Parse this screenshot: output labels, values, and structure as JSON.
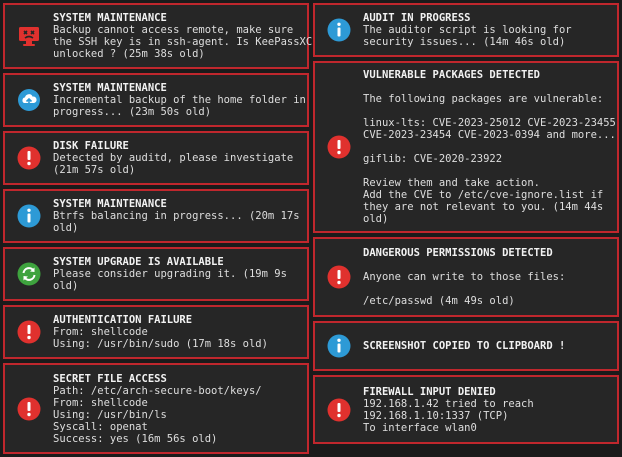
{
  "colors": {
    "border": "#c0272d",
    "background": "#262626",
    "danger": "#e0312e",
    "info": "#2d9ad6",
    "success": "#3ea33e"
  },
  "notifications": [
    {
      "id": "n1",
      "icon": "broken-screen-icon",
      "title": "SYSTEM MAINTENANCE",
      "lines": [
        "Backup cannot access remote, make sure",
        "the SSH key is in ssh-agent. Is KeePassXC",
        "unlocked ? (25m 38s old)"
      ]
    },
    {
      "id": "n2",
      "icon": "cloud-upload-icon",
      "title": "SYSTEM MAINTENANCE",
      "lines": [
        "Incremental backup of the home folder in",
        "progress... (23m 50s old)"
      ]
    },
    {
      "id": "n3",
      "icon": "exclamation-icon",
      "title": "DISK FAILURE",
      "lines": [
        "Detected by auditd, please investigate",
        "(21m 57s old)"
      ]
    },
    {
      "id": "n4",
      "icon": "info-icon",
      "title": "SYSTEM MAINTENANCE",
      "lines": [
        "Btrfs balancing in progress... (20m 17s",
        "old)"
      ]
    },
    {
      "id": "n5",
      "icon": "refresh-icon",
      "title": "SYSTEM UPGRADE IS AVAILABLE",
      "lines": [
        "Please consider upgrading it. (19m 9s",
        "old)"
      ]
    },
    {
      "id": "n6",
      "icon": "exclamation-icon",
      "title": "AUTHENTICATION FAILURE",
      "lines": [
        "From: shellcode",
        "Using: /usr/bin/sudo (17m 18s old)"
      ]
    },
    {
      "id": "n7",
      "icon": "exclamation-icon",
      "title": "SECRET FILE ACCESS",
      "lines": [
        "Path: /etc/arch-secure-boot/keys/",
        "From: shellcode",
        "Using: /usr/bin/ls",
        "Syscall: openat",
        "Success: yes (16m 56s old)"
      ]
    },
    {
      "id": "n8",
      "icon": "info-icon",
      "title": "AUDIT IN PROGRESS",
      "lines": [
        "The auditor script is looking for",
        "security issues... (14m 46s old)"
      ]
    },
    {
      "id": "n9",
      "icon": "exclamation-icon",
      "title": "VULNERABLE PACKAGES DETECTED",
      "lines": [
        "",
        "The following packages are vulnerable:",
        "",
        "linux-lts: CVE-2023-25012 CVE-2023-23455",
        "CVE-2023-23454 CVE-2023-0394 and more...",
        "",
        "giflib: CVE-2020-23922",
        "",
        "Review them and take action.",
        "Add the CVE to /etc/cve-ignore.list if",
        "they are not relevant to you. (14m 44s",
        "old)"
      ]
    },
    {
      "id": "n10",
      "icon": "exclamation-icon",
      "title": "DANGEROUS PERMISSIONS DETECTED",
      "lines": [
        "",
        "Anyone can write to those files:",
        "",
        "/etc/passwd (4m 49s old)"
      ]
    },
    {
      "id": "n11",
      "icon": "info-icon",
      "title": "SCREENSHOT COPIED TO CLIPBOARD !",
      "lines": []
    },
    {
      "id": "n12",
      "icon": "exclamation-icon",
      "title": "FIREWALL INPUT DENIED",
      "lines": [
        "192.168.1.42 tried to reach",
        "192.168.1.10:1337 (TCP)",
        "To interface wlan0"
      ]
    }
  ]
}
